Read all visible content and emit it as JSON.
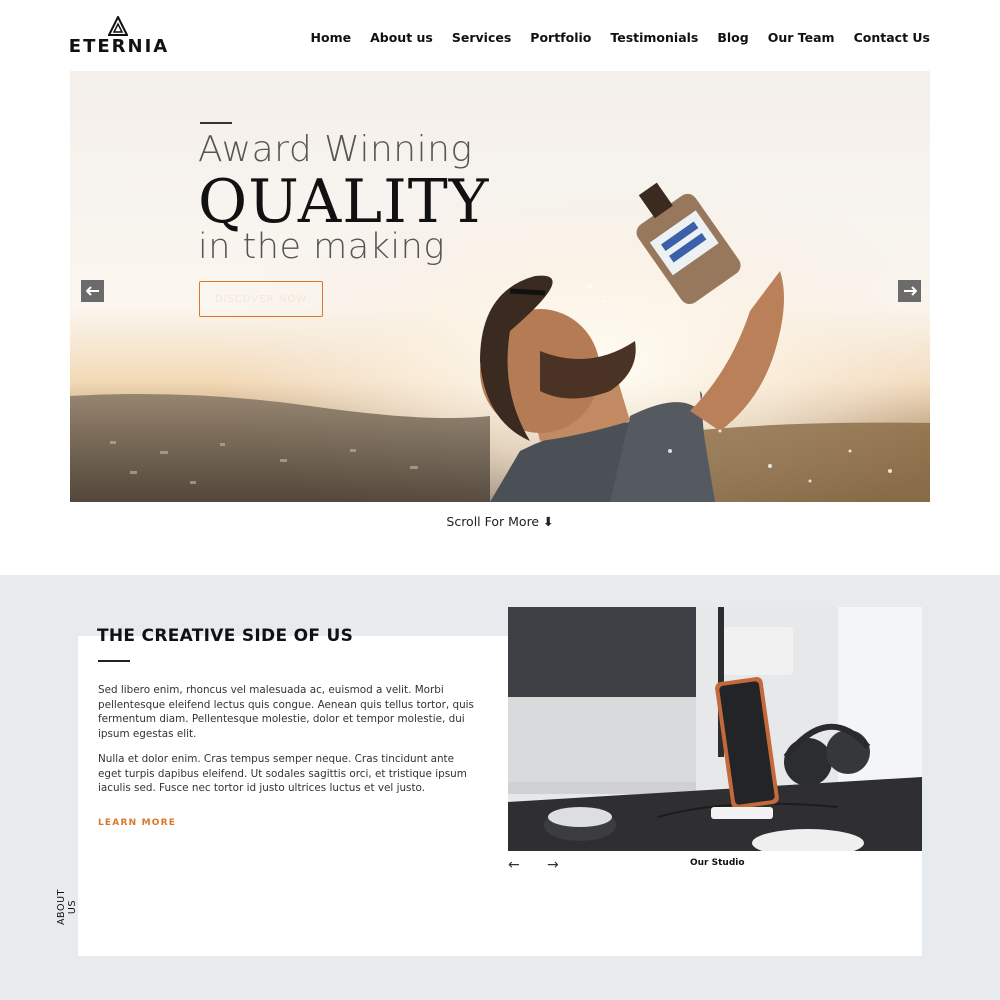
{
  "header": {
    "logo_text": "ETERNIA",
    "nav": [
      "Home",
      "About us",
      "Services",
      "Portfolio",
      "Testimonials",
      "Blog",
      "Our Team",
      "Contact Us"
    ]
  },
  "hero": {
    "line1": "Award Winning",
    "line2": "QUALITY",
    "line3": "in the making",
    "button_label": "DISCOVER NOW",
    "prev_icon": "arrow-left-icon",
    "next_icon": "arrow-right-icon"
  },
  "scroll": {
    "label": "Scroll For More",
    "icon": "arrow-down-icon"
  },
  "about": {
    "title": "THE CREATIVE SIDE OF US",
    "paragraph1": "Sed libero enim, rhoncus vel malesuada ac, euismod a velit. Morbi pellentesque eleifend lectus quis congue. Aenean quis tellus tortor, quis fermentum diam. Pellentesque molestie, dolor et tempor molestie, dui ipsum egestas elit.",
    "paragraph2": "Nulla et dolor enim. Cras tempus semper neque. Cras tincidunt ante eget turpis dapibus eleifend. Ut sodales sagittis orci, et tristique ipsum iaculis sed. Fusce nec tortor id justo ultrices luctus et vel justo.",
    "learn_more": "LEARN MORE",
    "side_label": "ABOUT US",
    "studio_caption": "Our Studio",
    "prev_arrow": "←",
    "next_arrow": "→"
  },
  "colors": {
    "accent": "#d9782a",
    "section_bg": "#e8ebee"
  }
}
